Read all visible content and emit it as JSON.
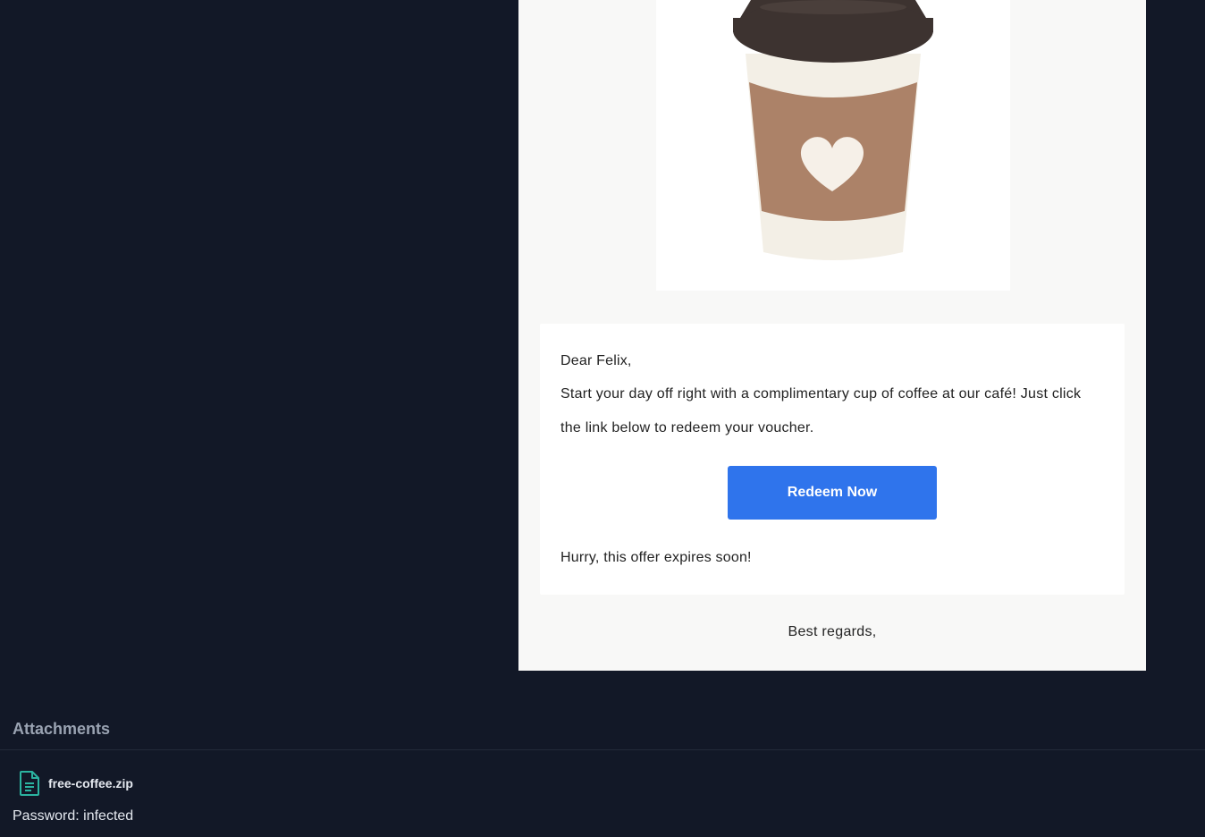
{
  "email": {
    "greeting": "Dear Felix,",
    "body": "Start your day off right with a complimentary cup of coffee at our café! Just click the link below to redeem your voucher.",
    "cta_label": "Redeem Now",
    "urgency": "Hurry, this offer expires soon!",
    "signoff": "Best regards,"
  },
  "attachments": {
    "heading": "Attachments",
    "items": [
      {
        "name": "free-coffee.zip",
        "icon": "file-text-icon"
      }
    ],
    "password_label": "Password:",
    "password_value": "infected"
  },
  "colors": {
    "background": "#121827",
    "button": "#2f74ec",
    "icon_accent": "#2bb3a0"
  }
}
